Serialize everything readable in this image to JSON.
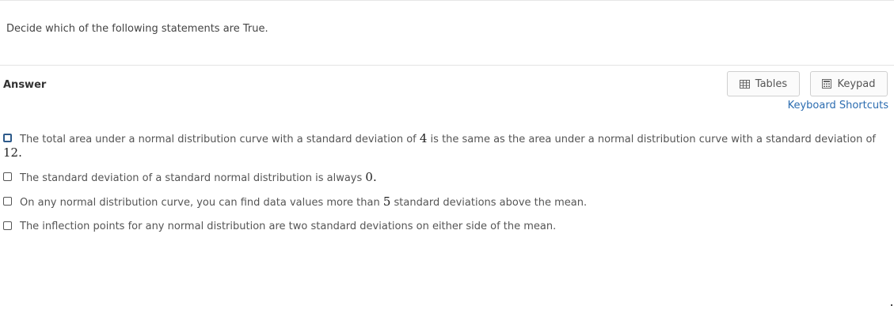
{
  "question": {
    "prompt": "Decide which of the following statements are True."
  },
  "answer": {
    "label": "Answer",
    "tables_label": "Tables",
    "keypad_label": "Keypad",
    "shortcuts_label": "Keyboard Shortcuts"
  },
  "options": [
    {
      "text_before": "The total area under a normal distribution curve with a standard deviation of ",
      "value_a": "4",
      "text_middle": " is the same as the area under a normal distribution curve with a standard deviation of ",
      "value_b": "12.",
      "checked": false
    },
    {
      "text_before": "The standard deviation of a standard normal distribution is always ",
      "value": "0.",
      "checked": false
    },
    {
      "text_before": "On any normal distribution curve, you can find data values more than ",
      "value": "5",
      "text_after": " standard deviations above the mean.",
      "checked": false
    },
    {
      "text_before": "The inflection points for any normal distribution are two standard deviations on either side of the mean.",
      "checked": false
    }
  ],
  "colors": {
    "link": "#2b6cb0",
    "focus_border": "#2d5a8a",
    "text": "#555555"
  }
}
